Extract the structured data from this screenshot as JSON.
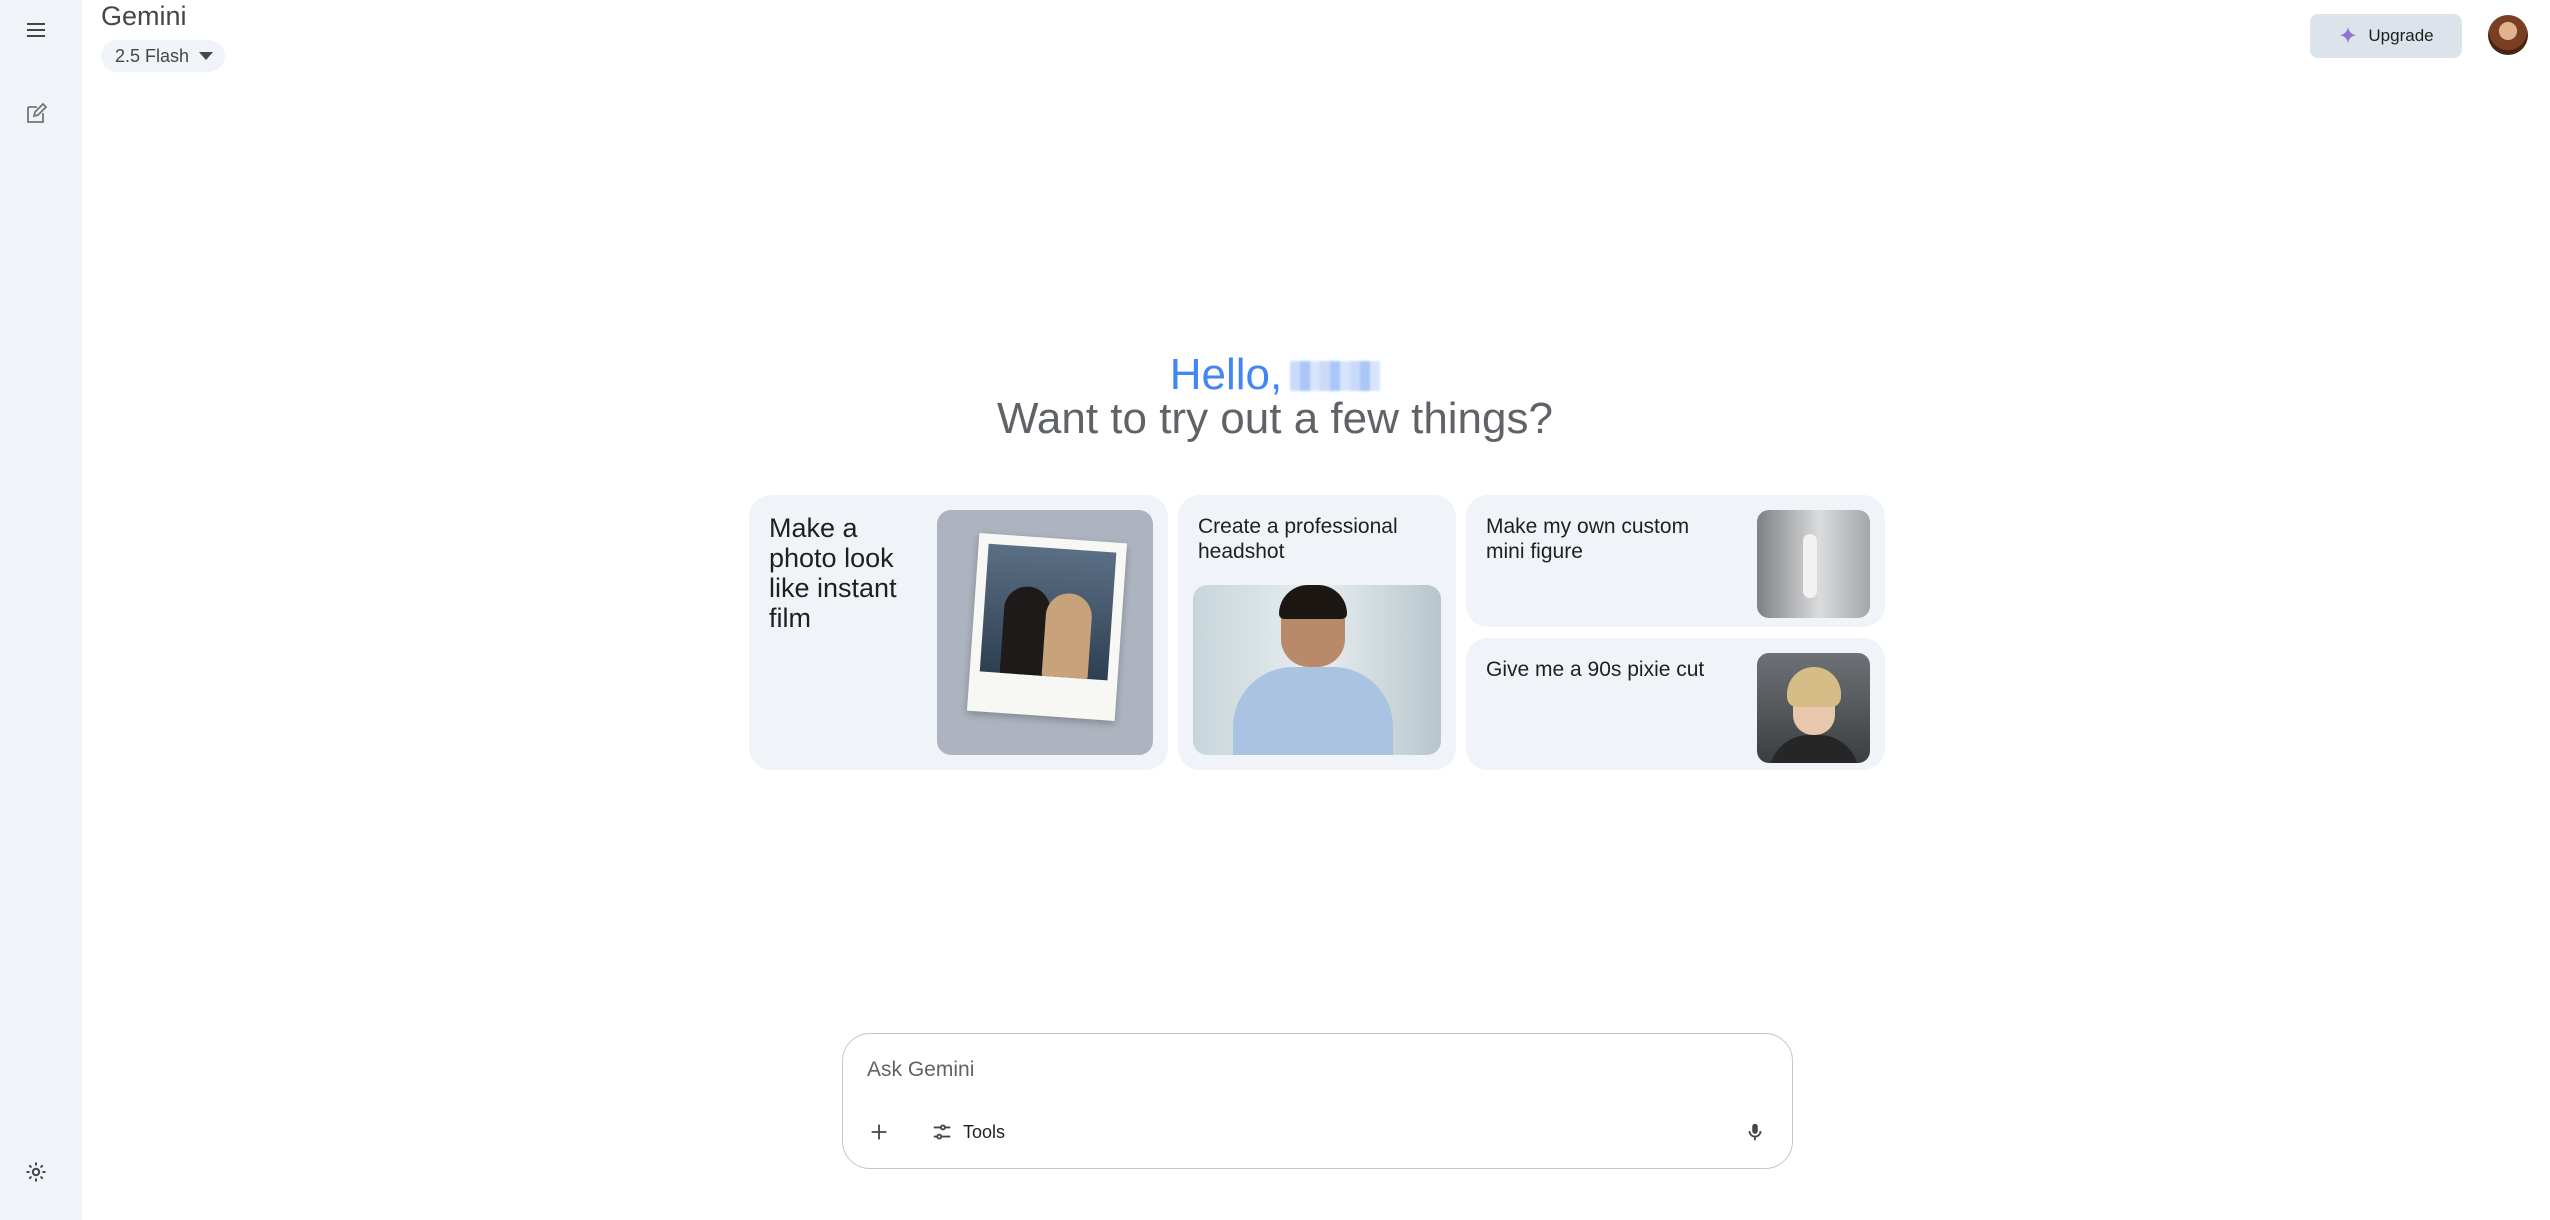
{
  "header": {
    "title": "Gemini",
    "model": "2.5 Flash",
    "upgrade_label": "Upgrade"
  },
  "greeting": {
    "hello": "Hello,",
    "subtitle": "Want to try out a few things?"
  },
  "cards": [
    {
      "label": "Make a photo look like instant film"
    },
    {
      "label": "Create a professional headshot"
    },
    {
      "label": "Make my own custom mini figure"
    },
    {
      "label": "Give me a 90s pixie cut"
    }
  ],
  "prompt": {
    "placeholder": "Ask Gemini",
    "tools_label": "Tools"
  },
  "icons": {
    "menu": "menu-icon",
    "new_chat": "edit-icon",
    "settings": "gear-icon",
    "upgrade": "sparkle-icon",
    "add": "plus-icon",
    "tools": "tune-icon",
    "mic": "mic-icon"
  },
  "colors": {
    "sidebar_bg": "#f0f4f9",
    "hello_blue": "#4285f4",
    "card_bg": "#f0f4f9",
    "upgrade_bg": "#dde3ea"
  }
}
